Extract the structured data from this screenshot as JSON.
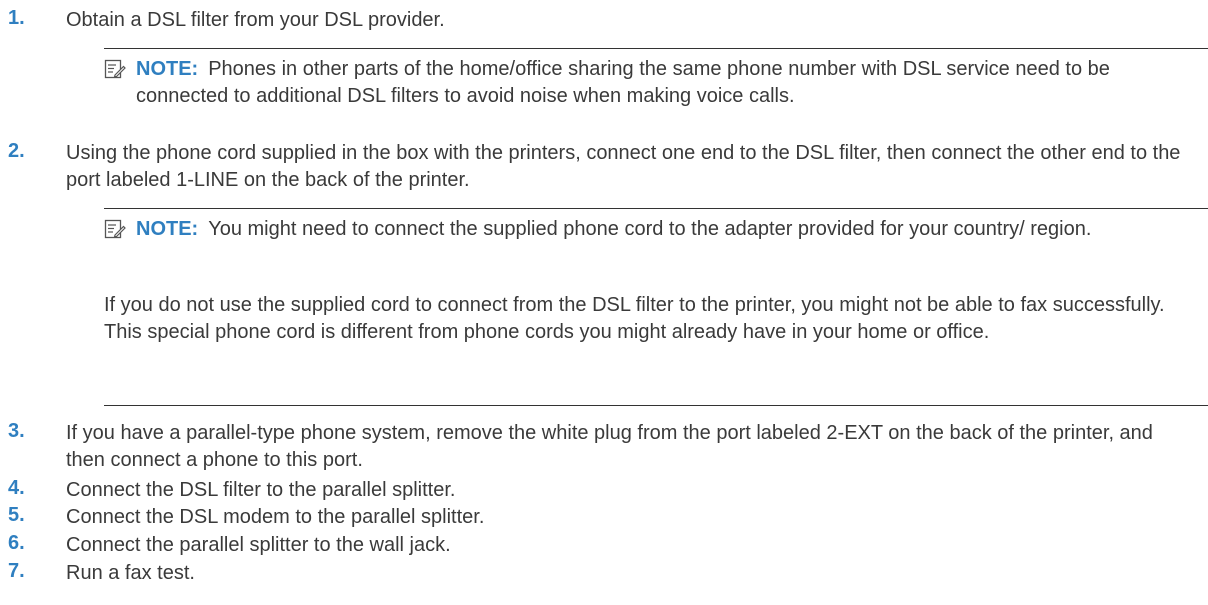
{
  "steps": [
    {
      "num": "1.",
      "text": "Obtain a DSL filter from your DSL provider."
    },
    {
      "num": "2.",
      "text": "Using the phone cord supplied in the box with the printers, connect one end to the DSL filter, then connect the other end to the port labeled 1-LINE on the back of the printer."
    },
    {
      "num": "3.",
      "text": "If you have a parallel-type phone system, remove the white plug from the port labeled 2-EXT on the back of the printer, and then connect a phone to this port."
    },
    {
      "num": "4.",
      "text": "Connect the DSL filter to the parallel splitter."
    },
    {
      "num": "5.",
      "text": "Connect the DSL modem to the parallel splitter."
    },
    {
      "num": "6.",
      "text": "Connect the parallel splitter to the wall jack."
    },
    {
      "num": "7.",
      "text": "Run a fax test."
    }
  ],
  "notes": [
    {
      "label": "NOTE:",
      "text": "Phones in other parts of the home/office sharing the same phone number with DSL service need to be connected to additional DSL filters to avoid noise when making voice calls."
    },
    {
      "label": "NOTE:",
      "text": "You might need to connect the supplied phone cord to the adapter provided for your country/ region.",
      "paragraph": "If you do not use the supplied cord to connect from the DSL filter to the printer, you might not be able to fax successfully. This special phone cord is different from phone cords you might already have in your home or office."
    }
  ],
  "icons": {
    "note": "note-pencil-icon"
  }
}
